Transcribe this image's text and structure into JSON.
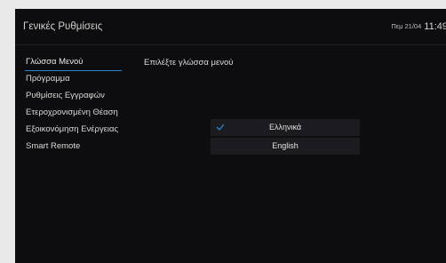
{
  "header": {
    "title": "Γενικές Ρυθμίσεις",
    "date": "Πεμ 21/04",
    "time": "11:49"
  },
  "menu": {
    "items": [
      {
        "label": "Γλώσσα Μενού",
        "active": true
      },
      {
        "label": "Πρόγραμμα"
      },
      {
        "label": "Ρυθμίσεις Εγγραφών"
      },
      {
        "label": "Ετεροχρονισμένη Θέαση"
      },
      {
        "label": "Εξοικονόμηση Ενέργειας"
      },
      {
        "label": "Smart Remote"
      }
    ]
  },
  "content": {
    "title": "Επιλέξτε γλώσσα μενού",
    "options": [
      {
        "label": "Ελληνικά",
        "selected": true
      },
      {
        "label": "English",
        "selected": false
      }
    ]
  },
  "colors": {
    "accent": "#2d86c9",
    "background": "#0d0d0f",
    "option_background": "#1c1c20"
  },
  "icons": {
    "selected_option": "check-icon"
  }
}
